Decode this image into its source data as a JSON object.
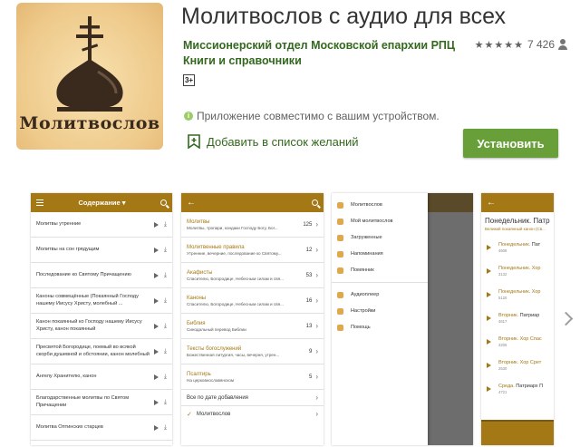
{
  "app": {
    "title": "Молитвослов с аудио для всех",
    "developer": "Миссионерский отдел Московской епархии РПЦ",
    "category": "Книги и справочники",
    "rating_count": "7 426",
    "age_rating": "3+",
    "compat_text": "Приложение совместимо с вашим устройством.",
    "wishlist_label": "Добавить в список желаний",
    "install_label": "Установить",
    "icon_text": "Молитвослов"
  },
  "colors": {
    "accent": "#689f38",
    "brand": "#a57816"
  },
  "shot1": {
    "title": "Содержание ▾",
    "items": [
      "Молитвы утренние",
      "Молитвы на сон грядущим",
      "Последование ко Святому Причащению",
      "Каноны совмещённые (Покаянный Господу нашему Иисусу Христу, молебный ...",
      "Канон покаянный ко Господу нашему Иисусу Христу, канон покаянный",
      "Пресвятой Богородице, поемый во всякой скорби душевной и обстоянии, канон молебный",
      "Ангелу Хранителю, канон",
      "Благодарственные молитвы по Святом Причащении",
      "Молитва Оптинских старцев"
    ]
  },
  "shot2": {
    "items": [
      {
        "t": "Молитвы",
        "s": "Молитвы, тропари, кондаки Господу Богу, Бог...",
        "n": "125"
      },
      {
        "t": "Молитвенные правила",
        "s": "Утренние, вечерние, последование ко Святому...",
        "n": "12"
      },
      {
        "t": "Акафисты",
        "s": "Спасителю, Богородице, Небесным силам и свя...",
        "n": "53"
      },
      {
        "t": "Каноны",
        "s": "Спасителю, Богородице, Небесным силам и свя...",
        "n": "16"
      },
      {
        "t": "Библия",
        "s": "Синодальный перевод Библии",
        "n": "13"
      },
      {
        "t": "Тексты богослужений",
        "s": "Божественная литургия, часы, вечерня, утрен...",
        "n": "9"
      },
      {
        "t": "Псалтирь",
        "s": "На церковнославянском",
        "n": "5"
      }
    ],
    "sort_label": "Все по дате добавления",
    "bottom_label": "Молитвослов"
  },
  "shot3": {
    "items": [
      "Молитвослов",
      "Мой молитвослов",
      "Загруженные",
      "Напоминания",
      "Помянник"
    ],
    "items2": [
      "Аудиоплеер",
      "Настройки",
      "Помощь"
    ]
  },
  "shot4": {
    "title": "Понедельник. Патр",
    "sub": "Великий покаянный канон (Св...",
    "rows": [
      {
        "a": "Понедельник. ",
        "b": "Пат",
        "c": "4608"
      },
      {
        "a": "Понедельник. Хор",
        "b": "",
        "c": "3132"
      },
      {
        "a": "Понедельник. Хор",
        "b": "",
        "c": "5120"
      },
      {
        "a": "Вторник. ",
        "b": "Патриар",
        "c": "4617"
      },
      {
        "a": "Вторник. Хор Спас",
        "b": "",
        "c": "3205"
      },
      {
        "a": "Вторник. Хор Срет",
        "b": "",
        "c": "2530"
      },
      {
        "a": "Среда. ",
        "b": "Патриарх П",
        "c": "4721"
      }
    ]
  }
}
